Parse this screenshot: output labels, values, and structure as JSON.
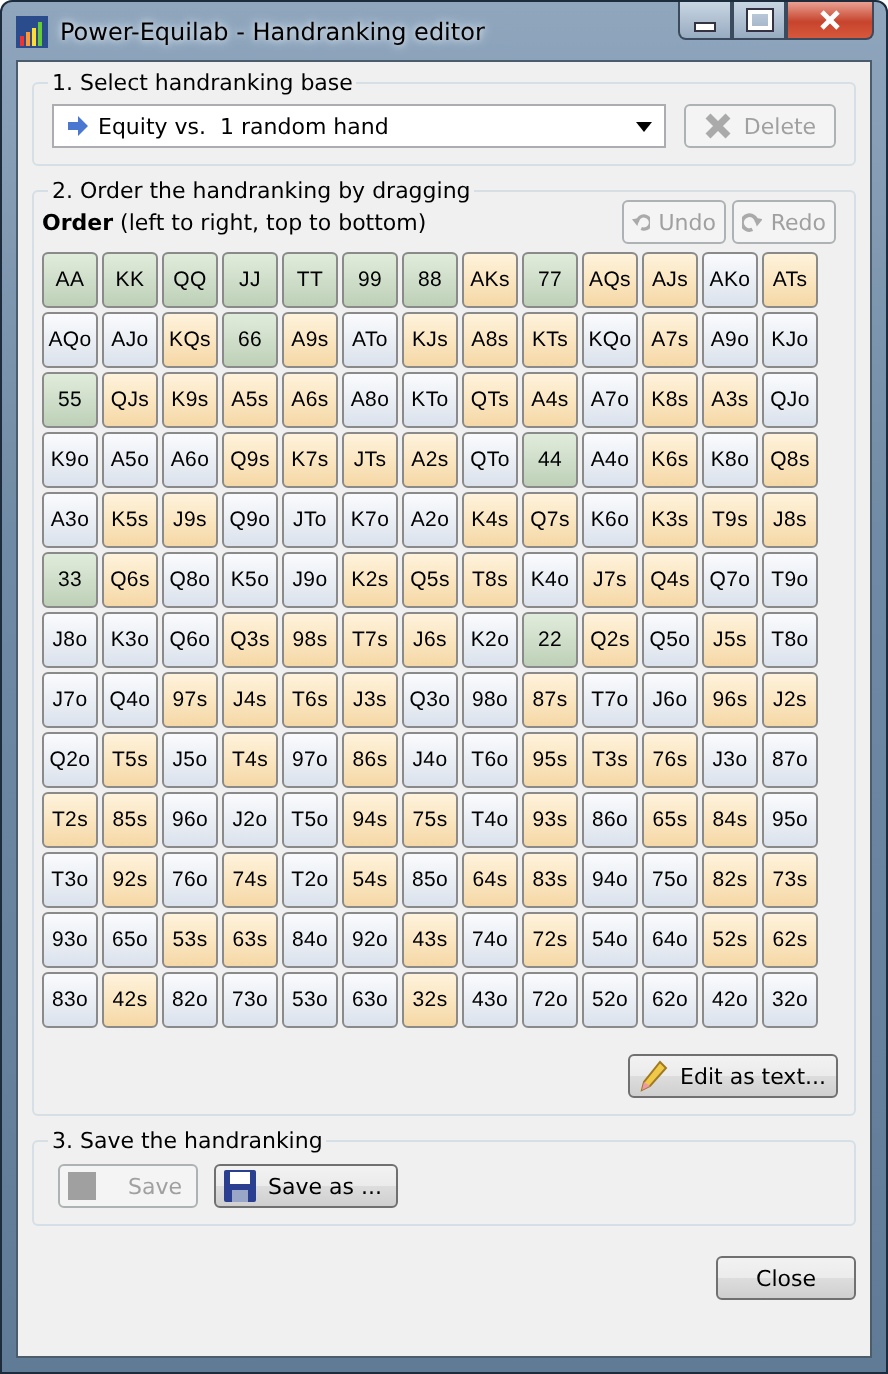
{
  "window": {
    "title": "Power-Equilab - Handranking editor"
  },
  "base_group": {
    "legend": "1. Select handranking base",
    "combo": {
      "value": "Equity vs.  1 random hand"
    },
    "delete_button": {
      "label": "Delete",
      "disabled": true
    }
  },
  "order_group": {
    "legend": "2. Order the handranking by dragging",
    "order_label": "**Order** (left to right, top to bottom)",
    "undo_button": {
      "label": "Undo",
      "disabled": true
    },
    "redo_button": {
      "label": "Redo",
      "disabled": true
    },
    "cells": [
      {
        "hand": "AA",
        "kind": "pair"
      },
      {
        "hand": "KK",
        "kind": "pair"
      },
      {
        "hand": "QQ",
        "kind": "pair"
      },
      {
        "hand": "JJ",
        "kind": "pair"
      },
      {
        "hand": "TT",
        "kind": "pair"
      },
      {
        "hand": "99",
        "kind": "pair"
      },
      {
        "hand": "88",
        "kind": "pair"
      },
      {
        "hand": "AKs",
        "kind": "suited"
      },
      {
        "hand": "77",
        "kind": "pair"
      },
      {
        "hand": "AQs",
        "kind": "suited"
      },
      {
        "hand": "AJs",
        "kind": "suited"
      },
      {
        "hand": "AKo",
        "kind": "offsuit"
      },
      {
        "hand": "ATs",
        "kind": "suited"
      },
      {
        "hand": "AQo",
        "kind": "offsuit"
      },
      {
        "hand": "AJo",
        "kind": "offsuit"
      },
      {
        "hand": "KQs",
        "kind": "suited"
      },
      {
        "hand": "66",
        "kind": "pair"
      },
      {
        "hand": "A9s",
        "kind": "suited"
      },
      {
        "hand": "ATo",
        "kind": "offsuit"
      },
      {
        "hand": "KJs",
        "kind": "suited"
      },
      {
        "hand": "A8s",
        "kind": "suited"
      },
      {
        "hand": "KTs",
        "kind": "suited"
      },
      {
        "hand": "KQo",
        "kind": "offsuit"
      },
      {
        "hand": "A7s",
        "kind": "suited"
      },
      {
        "hand": "A9o",
        "kind": "offsuit"
      },
      {
        "hand": "KJo",
        "kind": "offsuit"
      },
      {
        "hand": "55",
        "kind": "pair"
      },
      {
        "hand": "QJs",
        "kind": "suited"
      },
      {
        "hand": "K9s",
        "kind": "suited"
      },
      {
        "hand": "A5s",
        "kind": "suited"
      },
      {
        "hand": "A6s",
        "kind": "suited"
      },
      {
        "hand": "A8o",
        "kind": "offsuit"
      },
      {
        "hand": "KTo",
        "kind": "offsuit"
      },
      {
        "hand": "QTs",
        "kind": "suited"
      },
      {
        "hand": "A4s",
        "kind": "suited"
      },
      {
        "hand": "A7o",
        "kind": "offsuit"
      },
      {
        "hand": "K8s",
        "kind": "suited"
      },
      {
        "hand": "A3s",
        "kind": "suited"
      },
      {
        "hand": "QJo",
        "kind": "offsuit"
      },
      {
        "hand": "K9o",
        "kind": "offsuit"
      },
      {
        "hand": "A5o",
        "kind": "offsuit"
      },
      {
        "hand": "A6o",
        "kind": "offsuit"
      },
      {
        "hand": "Q9s",
        "kind": "suited"
      },
      {
        "hand": "K7s",
        "kind": "suited"
      },
      {
        "hand": "JTs",
        "kind": "suited"
      },
      {
        "hand": "A2s",
        "kind": "suited"
      },
      {
        "hand": "QTo",
        "kind": "offsuit"
      },
      {
        "hand": "44",
        "kind": "pair"
      },
      {
        "hand": "A4o",
        "kind": "offsuit"
      },
      {
        "hand": "K6s",
        "kind": "suited"
      },
      {
        "hand": "K8o",
        "kind": "offsuit"
      },
      {
        "hand": "Q8s",
        "kind": "suited"
      },
      {
        "hand": "A3o",
        "kind": "offsuit"
      },
      {
        "hand": "K5s",
        "kind": "suited"
      },
      {
        "hand": "J9s",
        "kind": "suited"
      },
      {
        "hand": "Q9o",
        "kind": "offsuit"
      },
      {
        "hand": "JTo",
        "kind": "offsuit"
      },
      {
        "hand": "K7o",
        "kind": "offsuit"
      },
      {
        "hand": "A2o",
        "kind": "offsuit"
      },
      {
        "hand": "K4s",
        "kind": "suited"
      },
      {
        "hand": "Q7s",
        "kind": "suited"
      },
      {
        "hand": "K6o",
        "kind": "offsuit"
      },
      {
        "hand": "K3s",
        "kind": "suited"
      },
      {
        "hand": "T9s",
        "kind": "suited"
      },
      {
        "hand": "J8s",
        "kind": "suited"
      },
      {
        "hand": "33",
        "kind": "pair"
      },
      {
        "hand": "Q6s",
        "kind": "suited"
      },
      {
        "hand": "Q8o",
        "kind": "offsuit"
      },
      {
        "hand": "K5o",
        "kind": "offsuit"
      },
      {
        "hand": "J9o",
        "kind": "offsuit"
      },
      {
        "hand": "K2s",
        "kind": "suited"
      },
      {
        "hand": "Q5s",
        "kind": "suited"
      },
      {
        "hand": "T8s",
        "kind": "suited"
      },
      {
        "hand": "K4o",
        "kind": "offsuit"
      },
      {
        "hand": "J7s",
        "kind": "suited"
      },
      {
        "hand": "Q4s",
        "kind": "suited"
      },
      {
        "hand": "Q7o",
        "kind": "offsuit"
      },
      {
        "hand": "T9o",
        "kind": "offsuit"
      },
      {
        "hand": "J8o",
        "kind": "offsuit"
      },
      {
        "hand": "K3o",
        "kind": "offsuit"
      },
      {
        "hand": "Q6o",
        "kind": "offsuit"
      },
      {
        "hand": "Q3s",
        "kind": "suited"
      },
      {
        "hand": "98s",
        "kind": "suited"
      },
      {
        "hand": "T7s",
        "kind": "suited"
      },
      {
        "hand": "J6s",
        "kind": "suited"
      },
      {
        "hand": "K2o",
        "kind": "offsuit"
      },
      {
        "hand": "22",
        "kind": "pair"
      },
      {
        "hand": "Q2s",
        "kind": "suited"
      },
      {
        "hand": "Q5o",
        "kind": "offsuit"
      },
      {
        "hand": "J5s",
        "kind": "suited"
      },
      {
        "hand": "T8o",
        "kind": "offsuit"
      },
      {
        "hand": "J7o",
        "kind": "offsuit"
      },
      {
        "hand": "Q4o",
        "kind": "offsuit"
      },
      {
        "hand": "97s",
        "kind": "suited"
      },
      {
        "hand": "J4s",
        "kind": "suited"
      },
      {
        "hand": "T6s",
        "kind": "suited"
      },
      {
        "hand": "J3s",
        "kind": "suited"
      },
      {
        "hand": "Q3o",
        "kind": "offsuit"
      },
      {
        "hand": "98o",
        "kind": "offsuit"
      },
      {
        "hand": "87s",
        "kind": "suited"
      },
      {
        "hand": "T7o",
        "kind": "offsuit"
      },
      {
        "hand": "J6o",
        "kind": "offsuit"
      },
      {
        "hand": "96s",
        "kind": "suited"
      },
      {
        "hand": "J2s",
        "kind": "suited"
      },
      {
        "hand": "Q2o",
        "kind": "offsuit"
      },
      {
        "hand": "T5s",
        "kind": "suited"
      },
      {
        "hand": "J5o",
        "kind": "offsuit"
      },
      {
        "hand": "T4s",
        "kind": "suited"
      },
      {
        "hand": "97o",
        "kind": "offsuit"
      },
      {
        "hand": "86s",
        "kind": "suited"
      },
      {
        "hand": "J4o",
        "kind": "offsuit"
      },
      {
        "hand": "T6o",
        "kind": "offsuit"
      },
      {
        "hand": "95s",
        "kind": "suited"
      },
      {
        "hand": "T3s",
        "kind": "suited"
      },
      {
        "hand": "76s",
        "kind": "suited"
      },
      {
        "hand": "J3o",
        "kind": "offsuit"
      },
      {
        "hand": "87o",
        "kind": "offsuit"
      },
      {
        "hand": "T2s",
        "kind": "suited"
      },
      {
        "hand": "85s",
        "kind": "suited"
      },
      {
        "hand": "96o",
        "kind": "offsuit"
      },
      {
        "hand": "J2o",
        "kind": "offsuit"
      },
      {
        "hand": "T5o",
        "kind": "offsuit"
      },
      {
        "hand": "94s",
        "kind": "suited"
      },
      {
        "hand": "75s",
        "kind": "suited"
      },
      {
        "hand": "T4o",
        "kind": "offsuit"
      },
      {
        "hand": "93s",
        "kind": "suited"
      },
      {
        "hand": "86o",
        "kind": "offsuit"
      },
      {
        "hand": "65s",
        "kind": "suited"
      },
      {
        "hand": "84s",
        "kind": "suited"
      },
      {
        "hand": "95o",
        "kind": "offsuit"
      },
      {
        "hand": "T3o",
        "kind": "offsuit"
      },
      {
        "hand": "92s",
        "kind": "suited"
      },
      {
        "hand": "76o",
        "kind": "offsuit"
      },
      {
        "hand": "74s",
        "kind": "suited"
      },
      {
        "hand": "T2o",
        "kind": "offsuit"
      },
      {
        "hand": "54s",
        "kind": "suited"
      },
      {
        "hand": "85o",
        "kind": "offsuit"
      },
      {
        "hand": "64s",
        "kind": "suited"
      },
      {
        "hand": "83s",
        "kind": "suited"
      },
      {
        "hand": "94o",
        "kind": "offsuit"
      },
      {
        "hand": "75o",
        "kind": "offsuit"
      },
      {
        "hand": "82s",
        "kind": "suited"
      },
      {
        "hand": "73s",
        "kind": "suited"
      },
      {
        "hand": "93o",
        "kind": "offsuit"
      },
      {
        "hand": "65o",
        "kind": "offsuit"
      },
      {
        "hand": "53s",
        "kind": "suited"
      },
      {
        "hand": "63s",
        "kind": "suited"
      },
      {
        "hand": "84o",
        "kind": "offsuit"
      },
      {
        "hand": "92o",
        "kind": "offsuit"
      },
      {
        "hand": "43s",
        "kind": "suited"
      },
      {
        "hand": "74o",
        "kind": "offsuit"
      },
      {
        "hand": "72s",
        "kind": "suited"
      },
      {
        "hand": "54o",
        "kind": "offsuit"
      },
      {
        "hand": "64o",
        "kind": "offsuit"
      },
      {
        "hand": "52s",
        "kind": "suited"
      },
      {
        "hand": "62s",
        "kind": "suited"
      },
      {
        "hand": "83o",
        "kind": "offsuit"
      },
      {
        "hand": "42s",
        "kind": "suited"
      },
      {
        "hand": "82o",
        "kind": "offsuit"
      },
      {
        "hand": "73o",
        "kind": "offsuit"
      },
      {
        "hand": "53o",
        "kind": "offsuit"
      },
      {
        "hand": "63o",
        "kind": "offsuit"
      },
      {
        "hand": "32s",
        "kind": "suited"
      },
      {
        "hand": "43o",
        "kind": "offsuit"
      },
      {
        "hand": "72o",
        "kind": "offsuit"
      },
      {
        "hand": "52o",
        "kind": "offsuit"
      },
      {
        "hand": "62o",
        "kind": "offsuit"
      },
      {
        "hand": "42o",
        "kind": "offsuit"
      },
      {
        "hand": "32o",
        "kind": "offsuit"
      }
    ],
    "edit_button": {
      "label": "Edit as text...",
      "disabled": false
    }
  },
  "save_group": {
    "legend": "3. Save the handranking",
    "save_button": {
      "label": "Save",
      "disabled": true
    },
    "save_as_button": {
      "label": "Save as ...",
      "disabled": false
    }
  },
  "close_button": {
    "label": "Close",
    "disabled": false
  }
}
